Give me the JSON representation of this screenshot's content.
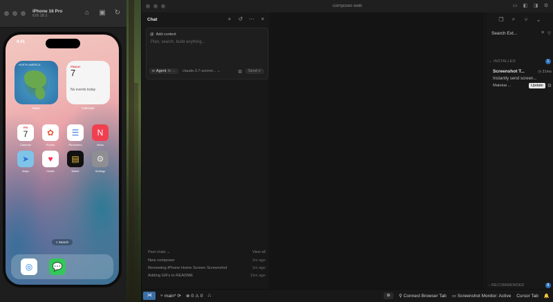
{
  "simulator": {
    "device": "iPhone 16 Pro",
    "os": "iOS 18.2",
    "status_time": "9:41",
    "map_widget_label": "Maps",
    "map_widget_tag": "NORTH AMERICA",
    "calendar_widget": {
      "weekday": "FRIDAY",
      "day": "7",
      "events": "No events today",
      "label": "Calendar"
    },
    "apps_row1": [
      {
        "label": "Calendar",
        "glyph": "7",
        "bg": "#ffffff",
        "fg": "#222222"
      },
      {
        "label": "Photos",
        "glyph": "✿",
        "bg": "#ffffff",
        "fg": "#e8583a"
      },
      {
        "label": "Reminders",
        "glyph": "☰",
        "bg": "#ffffff",
        "fg": "#3b7ae0"
      },
      {
        "label": "News",
        "glyph": "N",
        "bg": "#f04050",
        "fg": "#ffffff"
      }
    ],
    "apps_row2": [
      {
        "label": "Maps",
        "glyph": "➤",
        "bg": "#7fc3e8",
        "fg": "#2e6fd1"
      },
      {
        "label": "Health",
        "glyph": "♥",
        "bg": "#ffffff",
        "fg": "#ff2d55"
      },
      {
        "label": "Wallet",
        "glyph": "▤",
        "bg": "#111111",
        "fg": "#f0c040"
      },
      {
        "label": "Settings",
        "glyph": "⚙",
        "bg": "#8e8e93",
        "fg": "#e8e8e8"
      }
    ],
    "calendar_app_weekday": "FRI",
    "search_label": "Search",
    "dock": [
      {
        "name": "safari",
        "glyph": "◎",
        "bg": "#ffffff",
        "fg": "#1a7ae6"
      },
      {
        "name": "messages",
        "glyph": "💬",
        "bg": "#34c759",
        "fg": "#ffffff"
      }
    ]
  },
  "cursor": {
    "window_title": "composer-web",
    "chat": {
      "title": "Chat",
      "add_context": "Add context",
      "placeholder": "Plan, search, build anything...",
      "mode": "Agent",
      "mode_shortcut": "⌘I",
      "model": "claude-3.7-sonnet...",
      "send": "Send",
      "past_chats_label": "Past chats",
      "view_all": "View all",
      "past_chats": [
        {
          "title": "New composer",
          "when": "1m ago"
        },
        {
          "title": "Reviewing iPhone Home Screen Screenshot",
          "when": "1m ago"
        },
        {
          "title": "Adding GIFs to README",
          "when": "11m ago"
        }
      ]
    },
    "extensions": {
      "search_placeholder": "Search Ext...",
      "installed_label": "INSTALLED",
      "installed_count": "1",
      "item": {
        "name": "Screenshot T...",
        "time": "31ms",
        "description": "Instantly send screen...",
        "publisher": "Malekai ...",
        "update": "Update"
      },
      "recommended_label": "RECOMMENDED",
      "recommended_count": "8"
    },
    "status": {
      "branch": "main*",
      "errors": "0",
      "warnings": "0",
      "connect": "Connect Browser Tab",
      "monitor": "Screenshot Monitor: Active",
      "cursor_tab": "Cursor Tab"
    }
  }
}
